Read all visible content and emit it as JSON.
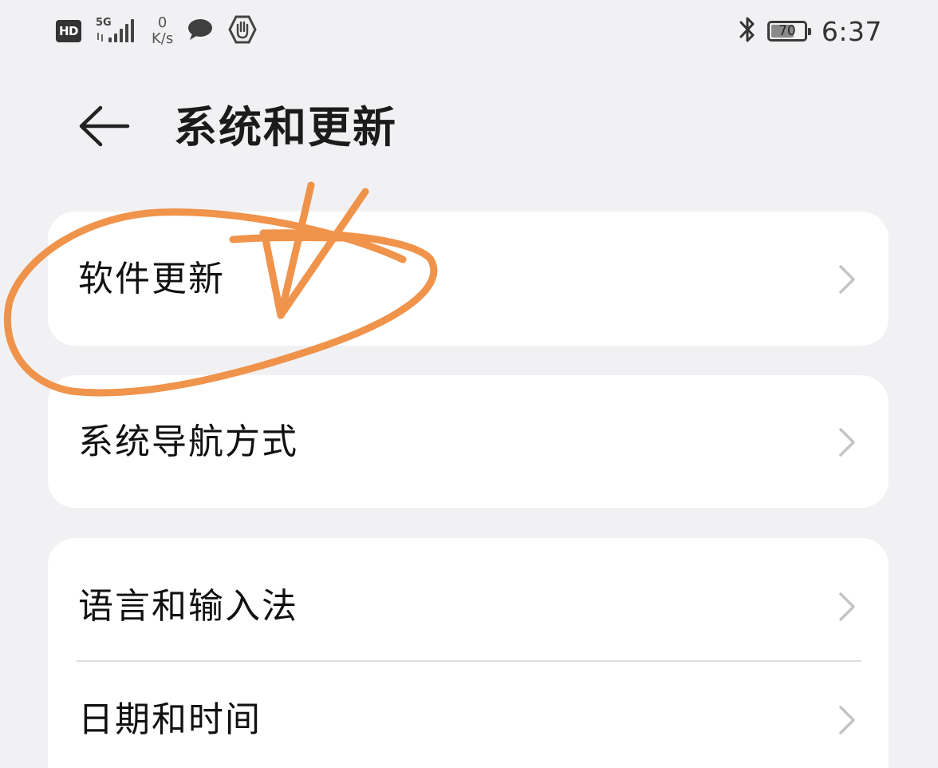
{
  "status_bar": {
    "hd_badge": "HD",
    "network_type": "5G",
    "speed_value": "0",
    "speed_unit": "K/s",
    "battery_level": "70",
    "battery_fraction": 0.7,
    "time": "6:37",
    "icons": [
      "hd-icon",
      "signal-icon",
      "message-icon",
      "hand-stop-icon",
      "bluetooth-icon",
      "battery-icon"
    ]
  },
  "header": {
    "title": "系统和更新",
    "back_icon": "arrow-left-icon"
  },
  "settings": {
    "groups": [
      {
        "items": [
          {
            "label": "软件更新",
            "icon": "chevron-right-icon"
          }
        ]
      },
      {
        "items": [
          {
            "label": "系统导航方式",
            "icon": "chevron-right-icon"
          }
        ]
      },
      {
        "items": [
          {
            "label": "语言和输入法",
            "icon": "chevron-right-icon"
          },
          {
            "label": "日期和时间",
            "icon": "chevron-right-icon"
          }
        ]
      }
    ]
  },
  "annotation": {
    "color": "#ef8a3c",
    "description_icon": "handwritten-circle-annotation"
  },
  "colors": {
    "background": "#f1f1f3",
    "card": "#ffffff",
    "text_primary": "#111111",
    "chevron": "#c4c4c4"
  }
}
